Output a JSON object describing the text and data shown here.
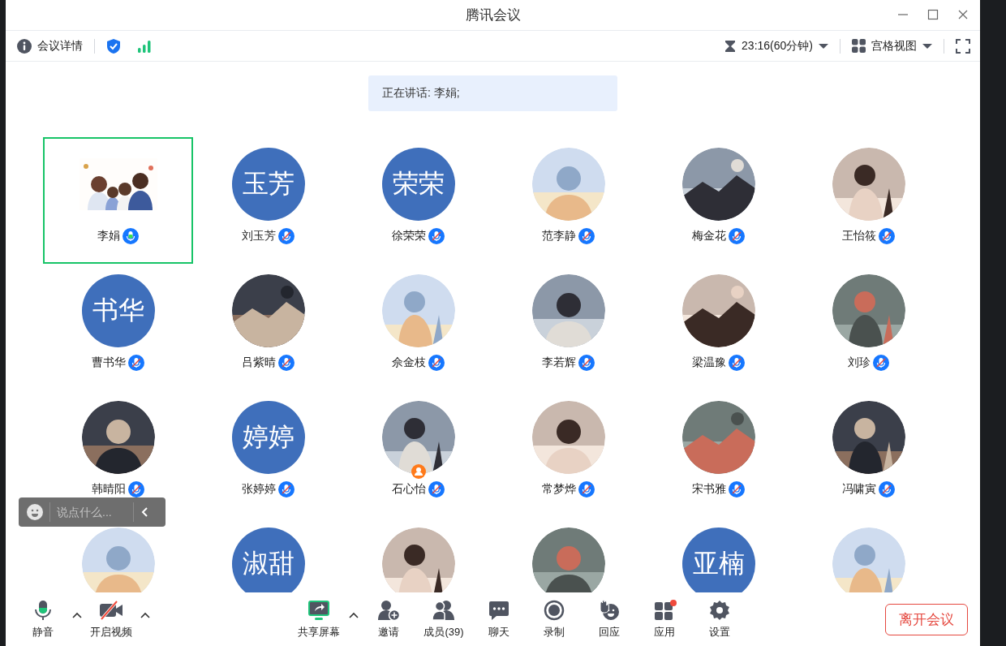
{
  "window": {
    "title": "腾讯会议"
  },
  "toolbar": {
    "details": "会议详情",
    "timer": "23:16(60分钟)",
    "view": "宫格视图"
  },
  "speaking_banner": "正在讲话: 李娟;",
  "participants": [
    {
      "name": "李娟",
      "avatar": {
        "kind": "drawing"
      },
      "muted": false,
      "host": false,
      "selected": true
    },
    {
      "name": "刘玉芳",
      "avatar": {
        "kind": "initials",
        "text": "玉芳"
      },
      "muted": true,
      "host": false,
      "selected": false
    },
    {
      "name": "徐荣荣",
      "avatar": {
        "kind": "initials",
        "text": "荣荣"
      },
      "muted": true,
      "host": false,
      "selected": false
    },
    {
      "name": "范李静",
      "muted": true,
      "host": false,
      "selected": false
    },
    {
      "name": "梅金花",
      "muted": true,
      "host": false,
      "selected": false
    },
    {
      "name": "王怡筱",
      "muted": true,
      "host": false,
      "selected": false
    },
    {
      "name": "曹书华",
      "avatar": {
        "kind": "initials",
        "text": "书华"
      },
      "muted": true,
      "host": false,
      "selected": false
    },
    {
      "name": "吕紫晴",
      "muted": true,
      "host": false,
      "selected": false
    },
    {
      "name": "佘金枝",
      "muted": true,
      "host": false,
      "selected": false
    },
    {
      "name": "李若辉",
      "muted": true,
      "host": false,
      "selected": false
    },
    {
      "name": "梁温豫",
      "muted": true,
      "host": false,
      "selected": false
    },
    {
      "name": "刘珍",
      "muted": true,
      "host": false,
      "selected": false
    },
    {
      "name": "韩晴阳",
      "muted": true,
      "host": false,
      "selected": false
    },
    {
      "name": "张婷婷",
      "avatar": {
        "kind": "initials",
        "text": "婷婷"
      },
      "muted": true,
      "host": false,
      "selected": false
    },
    {
      "name": "石心怡",
      "muted": true,
      "host": true,
      "selected": false
    },
    {
      "name": "常梦烨",
      "muted": true,
      "host": false,
      "selected": false
    },
    {
      "name": "宋书雅",
      "muted": true,
      "host": false,
      "selected": false
    },
    {
      "name": "冯啸寅",
      "muted": true,
      "host": false,
      "selected": false
    },
    {
      "host": false,
      "selected": false
    },
    {
      "avatar": {
        "kind": "initials",
        "text": "淑甜"
      },
      "host": false,
      "selected": false
    },
    {
      "host": false,
      "selected": false
    },
    {
      "host": false,
      "selected": false
    },
    {
      "avatar": {
        "kind": "initials",
        "text": "亚楠"
      },
      "host": false,
      "selected": false
    },
    {
      "host": false,
      "selected": false
    }
  ],
  "chat_box": {
    "placeholder": "说点什么..."
  },
  "controls_left": [
    {
      "kind": "mic",
      "label": "静音",
      "menu": true
    },
    {
      "kind": "camera-off",
      "label": "开启视频",
      "menu": true
    }
  ],
  "controls_center": [
    {
      "kind": "share",
      "label": "共享屏幕",
      "menu": true,
      "badge": false
    },
    {
      "kind": "invite",
      "label": "邀请",
      "menu": false,
      "badge": false
    },
    {
      "kind": "members",
      "label": "成员(39)",
      "menu": false,
      "badge": false
    },
    {
      "kind": "chat",
      "label": "聊天",
      "menu": false,
      "badge": false
    },
    {
      "kind": "record",
      "label": "录制",
      "menu": false,
      "badge": false
    },
    {
      "kind": "reaction",
      "label": "回应",
      "menu": false,
      "badge": false
    },
    {
      "kind": "apps",
      "label": "应用",
      "menu": false,
      "badge": true
    },
    {
      "kind": "settings",
      "label": "设置",
      "menu": false,
      "badge": false
    }
  ],
  "leave_button": "离开会议"
}
